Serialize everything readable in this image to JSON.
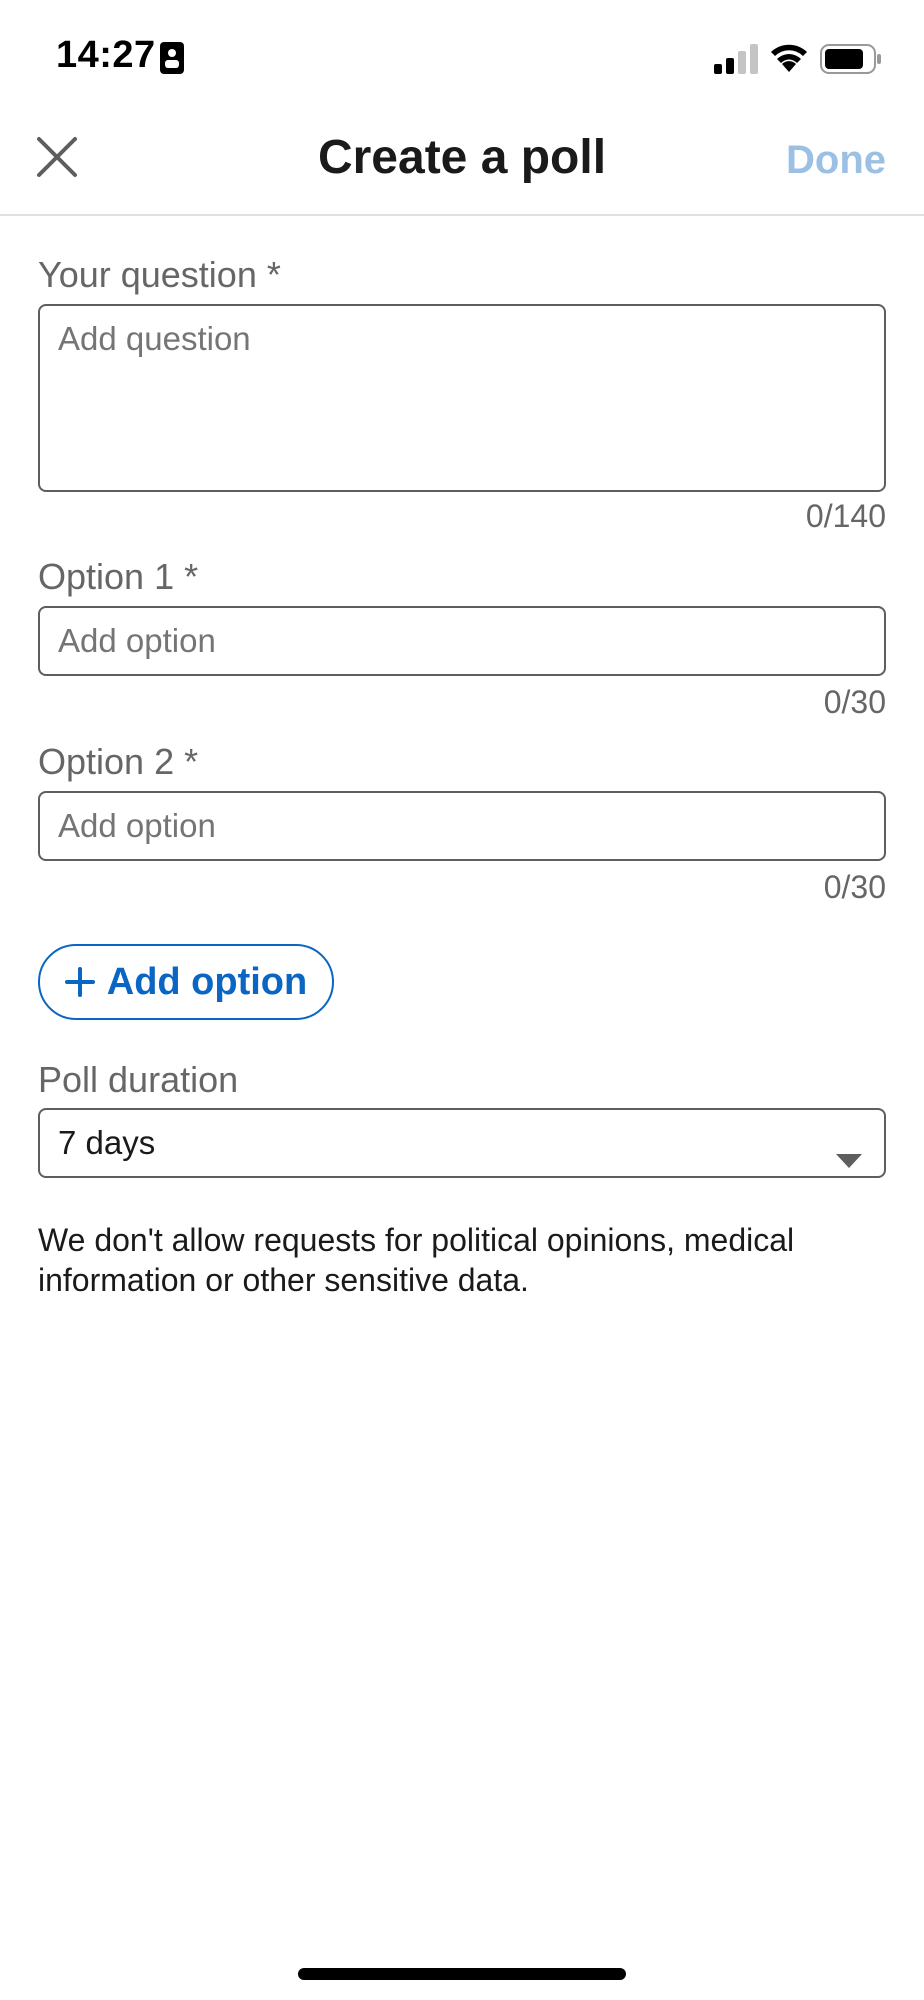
{
  "status_bar": {
    "time": "14:27"
  },
  "header": {
    "title": "Create a poll",
    "done_label": "Done"
  },
  "question": {
    "label": "Your question *",
    "placeholder": "Add question",
    "value": "",
    "counter": "0/140"
  },
  "options": [
    {
      "label": "Option 1 *",
      "placeholder": "Add option",
      "value": "",
      "counter": "0/30"
    },
    {
      "label": "Option 2 *",
      "placeholder": "Add option",
      "value": "",
      "counter": "0/30"
    }
  ],
  "add_option_label": "Add option",
  "duration": {
    "label": "Poll duration",
    "selected": "7 days"
  },
  "disclaimer": "We don't allow requests for political opinions, medical information or other sensitive data.",
  "colors": {
    "accent": "#0a66c2",
    "done_disabled": "#9cc0e3",
    "label_gray": "#666666",
    "border": "#5e5e5e"
  },
  "icons": {
    "close": "close-icon",
    "plus": "plus-icon",
    "dropdown": "caret-down-icon",
    "signal": "signal-icon",
    "wifi": "wifi-icon",
    "battery": "battery-icon",
    "sim": "sim-card-icon"
  }
}
